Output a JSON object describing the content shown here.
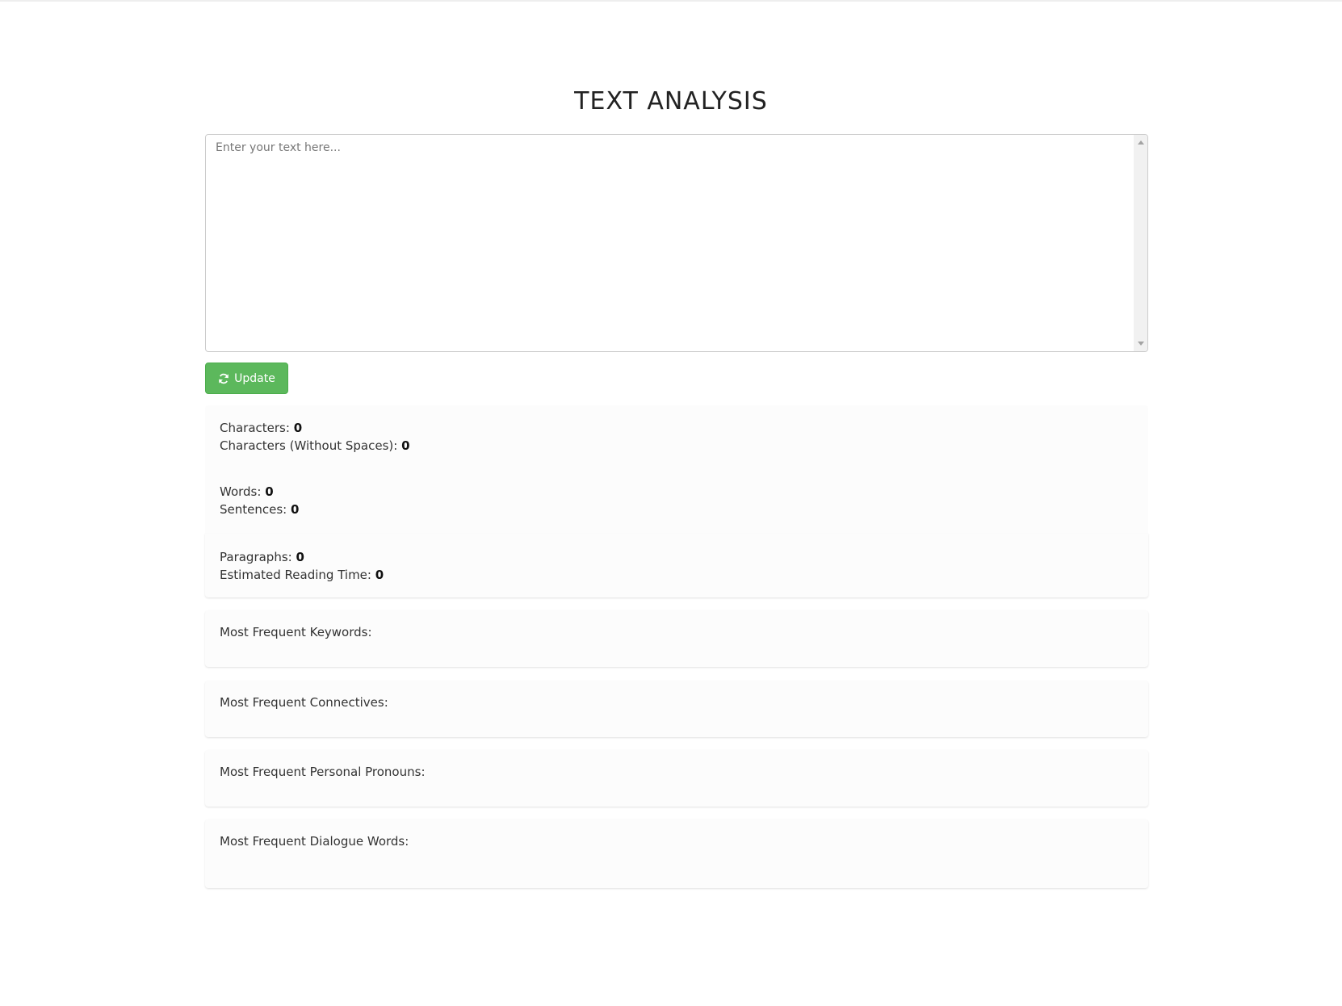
{
  "page": {
    "title": "TEXT ANALYSIS"
  },
  "editor": {
    "placeholder": "Enter your text here...",
    "value": ""
  },
  "update_button": {
    "label": "Update",
    "icon": "refresh-icon",
    "color": "#5cb85c"
  },
  "stats": {
    "characters": {
      "label": "Characters:",
      "value": "0"
    },
    "characters_no_spaces": {
      "label": "Characters (Without Spaces):",
      "value": "0"
    },
    "words": {
      "label": "Words:",
      "value": "0"
    },
    "sentences": {
      "label": "Sentences:",
      "value": "0"
    },
    "paragraphs": {
      "label": "Paragraphs:",
      "value": "0"
    },
    "reading_time": {
      "label": "Estimated Reading Time:",
      "value": "0"
    }
  },
  "frequency_sections": [
    {
      "label": "Most Frequent Keywords:"
    },
    {
      "label": "Most Frequent Connectives:"
    },
    {
      "label": "Most Frequent Personal Pronouns:"
    },
    {
      "label": "Most Frequent Dialogue Words:"
    }
  ]
}
